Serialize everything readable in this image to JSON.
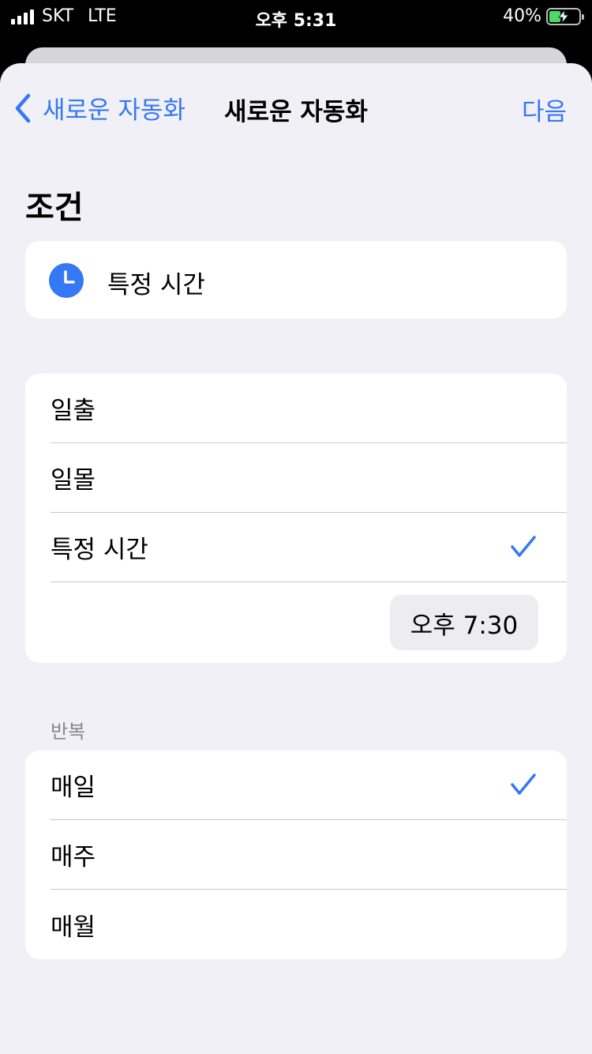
{
  "status_bar": {
    "carrier": "SKT",
    "network": "LTE",
    "time": "오후 5:31",
    "battery_percent": "40%",
    "battery_level": 0.4
  },
  "nav": {
    "back_label": "새로운 자동화",
    "title": "새로운 자동화",
    "next_label": "다음"
  },
  "condition": {
    "section_title": "조건",
    "selected_label": "특정 시간",
    "icon": "clock-icon"
  },
  "time_options": {
    "items": [
      {
        "label": "일출",
        "checked": false
      },
      {
        "label": "일몰",
        "checked": false
      },
      {
        "label": "특정 시간",
        "checked": true
      }
    ],
    "time_value": "오후 7:30"
  },
  "repeat": {
    "header": "반복",
    "items": [
      {
        "label": "매일",
        "checked": true
      },
      {
        "label": "매주",
        "checked": false
      },
      {
        "label": "매월",
        "checked": false
      }
    ]
  },
  "colors": {
    "accent": "#3478f6",
    "background": "#f1f0f6",
    "card": "#ffffff"
  }
}
